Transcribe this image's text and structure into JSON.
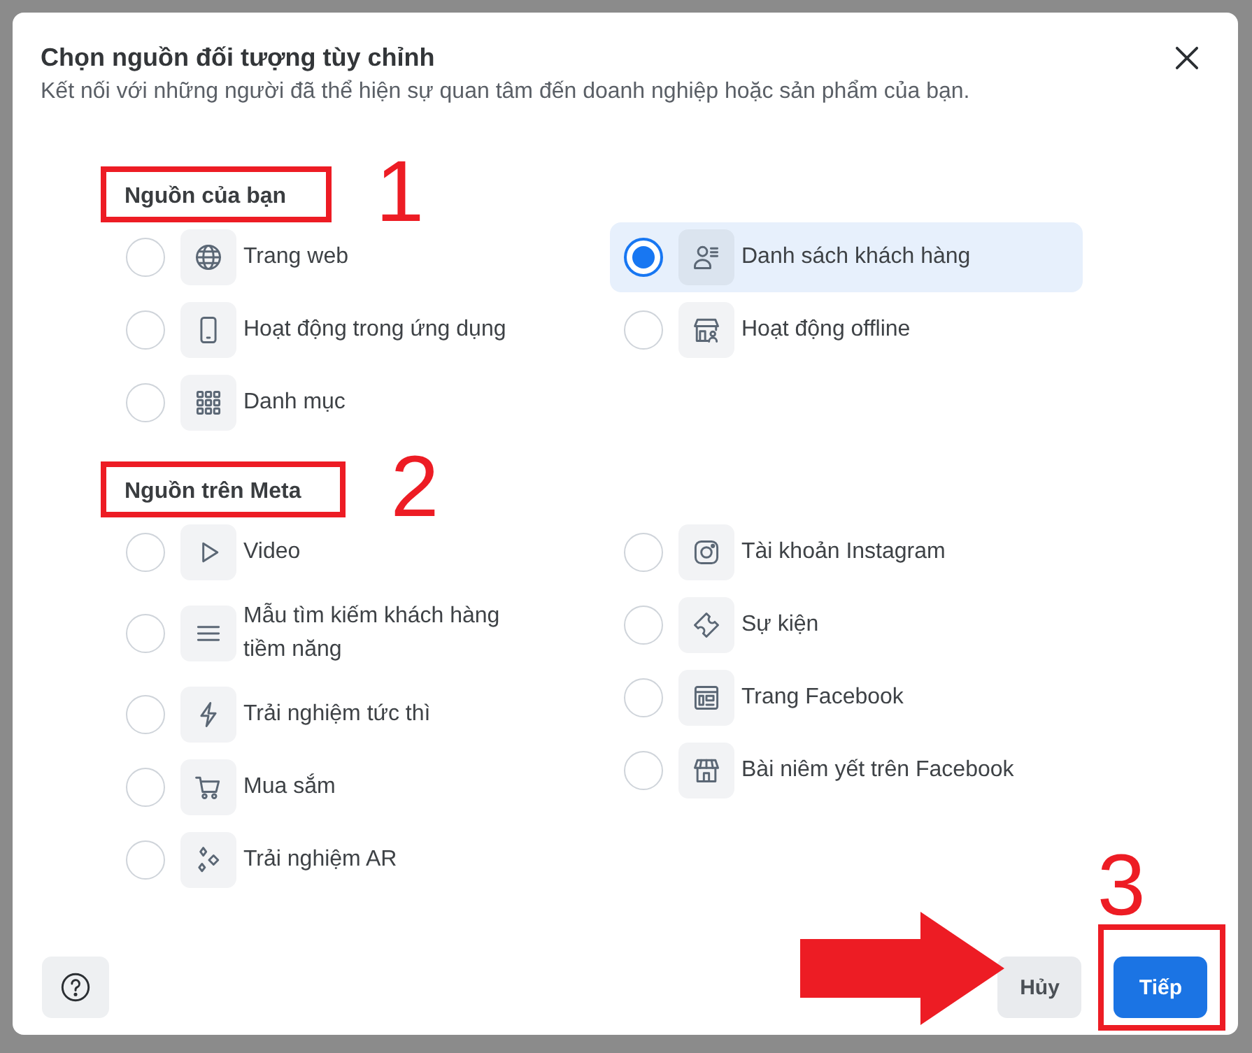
{
  "dialog": {
    "title": "Chọn nguồn đối tượng tùy chỉnh",
    "subtitle": "Kết nối với những người đã thể hiện sự quan tâm đến doanh nghiệp hoặc sản phẩm của bạn."
  },
  "sections": [
    {
      "heading": "Nguồn của bạn",
      "callout": "1",
      "columns": [
        [
          {
            "label": "Trang web",
            "selected": false
          },
          {
            "label": "Hoạt động trong ứng dụng",
            "selected": false
          },
          {
            "label": "Danh mục",
            "selected": false
          }
        ],
        [
          {
            "label": "Danh sách khách hàng",
            "selected": true
          },
          {
            "label": "Hoạt động offline",
            "selected": false
          }
        ]
      ]
    },
    {
      "heading": "Nguồn trên Meta",
      "callout": "2",
      "columns": [
        [
          {
            "label": "Video",
            "selected": false
          },
          {
            "label": "Mẫu tìm kiếm khách hàng tiềm năng",
            "selected": false
          },
          {
            "label": "Trải nghiệm tức thì",
            "selected": false
          },
          {
            "label": "Mua sắm",
            "selected": false
          },
          {
            "label": "Trải nghiệm AR",
            "selected": false
          }
        ],
        [
          {
            "label": "Tài khoản Instagram",
            "selected": false
          },
          {
            "label": "Sự kiện",
            "selected": false
          },
          {
            "label": "Trang Facebook",
            "selected": false
          },
          {
            "label": "Bài niêm yết trên Facebook",
            "selected": false
          }
        ]
      ]
    }
  ],
  "footer": {
    "buttons": [
      {
        "label": "Hủy",
        "kind": "secondary"
      },
      {
        "label": "Tiếp",
        "kind": "primary",
        "callout": "3",
        "callout_arrow": true
      }
    ]
  }
}
